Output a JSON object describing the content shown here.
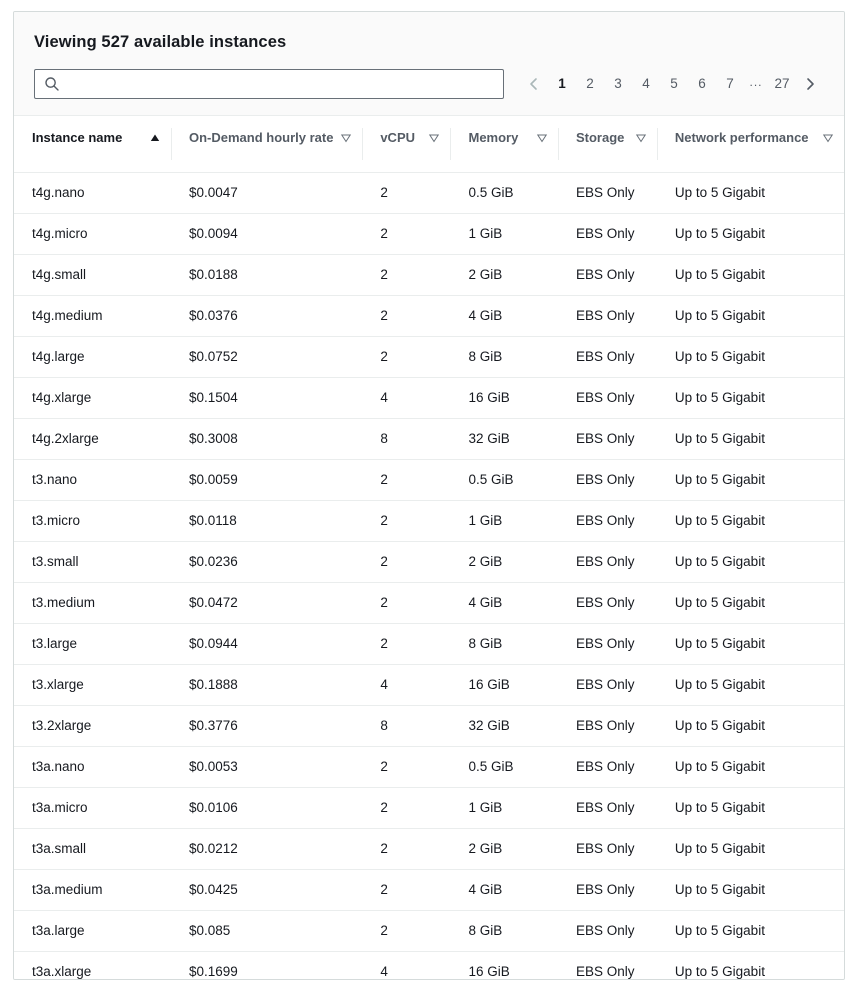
{
  "card": {
    "title": "Viewing 527 available instances"
  },
  "search": {
    "value": "",
    "placeholder": "",
    "icon": "search-icon"
  },
  "pagination": {
    "prev_icon": "chevron-left-icon",
    "next_icon": "chevron-right-icon",
    "current_page": "1",
    "pages": [
      "1",
      "2",
      "3",
      "4",
      "5",
      "6",
      "7"
    ],
    "ellipsis": "...",
    "last_page": "27"
  },
  "table": {
    "columns": [
      {
        "label": "Instance name",
        "sort_icon": "sort-ascending-icon",
        "sorted": true
      },
      {
        "label": "On-Demand hourly rate",
        "sort_icon": "sort-descending-icon",
        "sorted": false
      },
      {
        "label": "vCPU",
        "sort_icon": "sort-descending-icon",
        "sorted": false
      },
      {
        "label": "Memory",
        "sort_icon": "sort-descending-icon",
        "sorted": false
      },
      {
        "label": "Storage",
        "sort_icon": "sort-descending-icon",
        "sorted": false
      },
      {
        "label": "Network performance",
        "sort_icon": "sort-descending-icon",
        "sorted": false
      }
    ],
    "rows": [
      {
        "name": "t4g.nano",
        "rate": "$0.0047",
        "vcpu": "2",
        "memory": "0.5 GiB",
        "storage": "EBS Only",
        "network": "Up to 5 Gigabit"
      },
      {
        "name": "t4g.micro",
        "rate": "$0.0094",
        "vcpu": "2",
        "memory": "1 GiB",
        "storage": "EBS Only",
        "network": "Up to 5 Gigabit"
      },
      {
        "name": "t4g.small",
        "rate": "$0.0188",
        "vcpu": "2",
        "memory": "2 GiB",
        "storage": "EBS Only",
        "network": "Up to 5 Gigabit"
      },
      {
        "name": "t4g.medium",
        "rate": "$0.0376",
        "vcpu": "2",
        "memory": "4 GiB",
        "storage": "EBS Only",
        "network": "Up to 5 Gigabit"
      },
      {
        "name": "t4g.large",
        "rate": "$0.0752",
        "vcpu": "2",
        "memory": "8 GiB",
        "storage": "EBS Only",
        "network": "Up to 5 Gigabit"
      },
      {
        "name": "t4g.xlarge",
        "rate": "$0.1504",
        "vcpu": "4",
        "memory": "16 GiB",
        "storage": "EBS Only",
        "network": "Up to 5 Gigabit"
      },
      {
        "name": "t4g.2xlarge",
        "rate": "$0.3008",
        "vcpu": "8",
        "memory": "32 GiB",
        "storage": "EBS Only",
        "network": "Up to 5 Gigabit"
      },
      {
        "name": "t3.nano",
        "rate": "$0.0059",
        "vcpu": "2",
        "memory": "0.5 GiB",
        "storage": "EBS Only",
        "network": "Up to 5 Gigabit"
      },
      {
        "name": "t3.micro",
        "rate": "$0.0118",
        "vcpu": "2",
        "memory": "1 GiB",
        "storage": "EBS Only",
        "network": "Up to 5 Gigabit"
      },
      {
        "name": "t3.small",
        "rate": "$0.0236",
        "vcpu": "2",
        "memory": "2 GiB",
        "storage": "EBS Only",
        "network": "Up to 5 Gigabit"
      },
      {
        "name": "t3.medium",
        "rate": "$0.0472",
        "vcpu": "2",
        "memory": "4 GiB",
        "storage": "EBS Only",
        "network": "Up to 5 Gigabit"
      },
      {
        "name": "t3.large",
        "rate": "$0.0944",
        "vcpu": "2",
        "memory": "8 GiB",
        "storage": "EBS Only",
        "network": "Up to 5 Gigabit"
      },
      {
        "name": "t3.xlarge",
        "rate": "$0.1888",
        "vcpu": "4",
        "memory": "16 GiB",
        "storage": "EBS Only",
        "network": "Up to 5 Gigabit"
      },
      {
        "name": "t3.2xlarge",
        "rate": "$0.3776",
        "vcpu": "8",
        "memory": "32 GiB",
        "storage": "EBS Only",
        "network": "Up to 5 Gigabit"
      },
      {
        "name": "t3a.nano",
        "rate": "$0.0053",
        "vcpu": "2",
        "memory": "0.5 GiB",
        "storage": "EBS Only",
        "network": "Up to 5 Gigabit"
      },
      {
        "name": "t3a.micro",
        "rate": "$0.0106",
        "vcpu": "2",
        "memory": "1 GiB",
        "storage": "EBS Only",
        "network": "Up to 5 Gigabit"
      },
      {
        "name": "t3a.small",
        "rate": "$0.0212",
        "vcpu": "2",
        "memory": "2 GiB",
        "storage": "EBS Only",
        "network": "Up to 5 Gigabit"
      },
      {
        "name": "t3a.medium",
        "rate": "$0.0425",
        "vcpu": "2",
        "memory": "4 GiB",
        "storage": "EBS Only",
        "network": "Up to 5 Gigabit"
      },
      {
        "name": "t3a.large",
        "rate": "$0.085",
        "vcpu": "2",
        "memory": "8 GiB",
        "storage": "EBS Only",
        "network": "Up to 5 Gigabit"
      },
      {
        "name": "t3a.xlarge",
        "rate": "$0.1699",
        "vcpu": "4",
        "memory": "16 GiB",
        "storage": "EBS Only",
        "network": "Up to 5 Gigabit"
      }
    ]
  },
  "colors": {
    "text": "#16191f",
    "muted": "#545b64",
    "border": "#eaeded",
    "card_border": "#d5dbdb",
    "header_bg": "#fafafa"
  }
}
